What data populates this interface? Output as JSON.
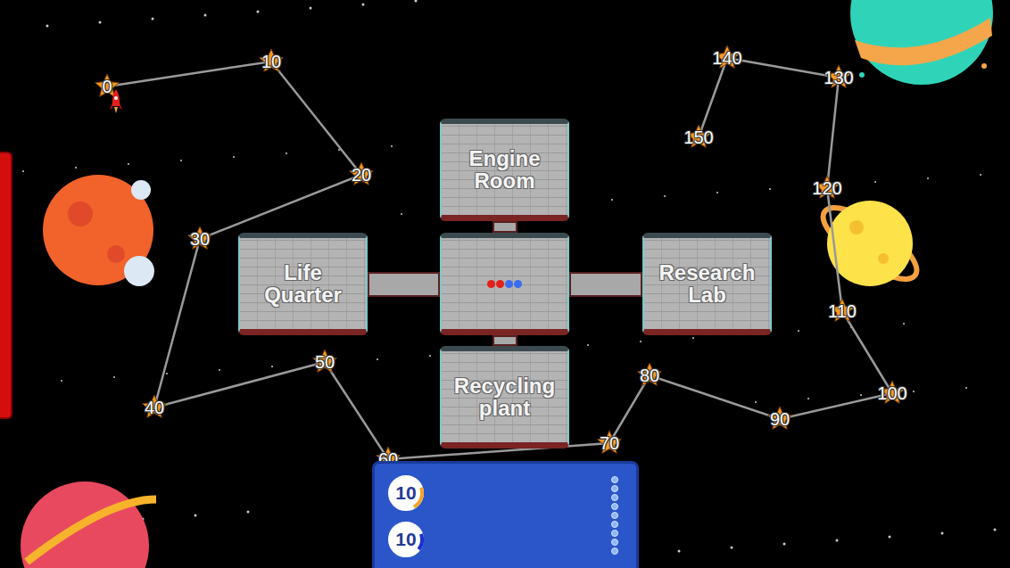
{
  "nodes": [
    {
      "label": "0"
    },
    {
      "label": "10"
    },
    {
      "label": "20"
    },
    {
      "label": "30"
    },
    {
      "label": "40"
    },
    {
      "label": "50"
    },
    {
      "label": "60"
    },
    {
      "label": "70"
    },
    {
      "label": "80"
    },
    {
      "label": "90"
    },
    {
      "label": "100"
    },
    {
      "label": "110"
    },
    {
      "label": "120"
    },
    {
      "label": "130"
    },
    {
      "label": "140"
    },
    {
      "label": "150"
    }
  ],
  "rocket": {
    "node": "0"
  },
  "rooms": [
    {
      "name": "Engine Room"
    },
    {
      "name": "Life Quarter"
    },
    {
      "name": "Research Lab"
    },
    {
      "name": "Recycling plant"
    }
  ],
  "hub": {
    "tokens": [
      {
        "color": "#e3201c"
      },
      {
        "color": "#e3201c"
      },
      {
        "color": "#3a6cf0"
      },
      {
        "color": "#3a6cf0"
      }
    ]
  },
  "timers": [
    {
      "value": "10",
      "level": 0.22,
      "color": "#f5a623"
    },
    {
      "value": "10",
      "level": 0.16,
      "color": "#1a2fd0"
    }
  ]
}
